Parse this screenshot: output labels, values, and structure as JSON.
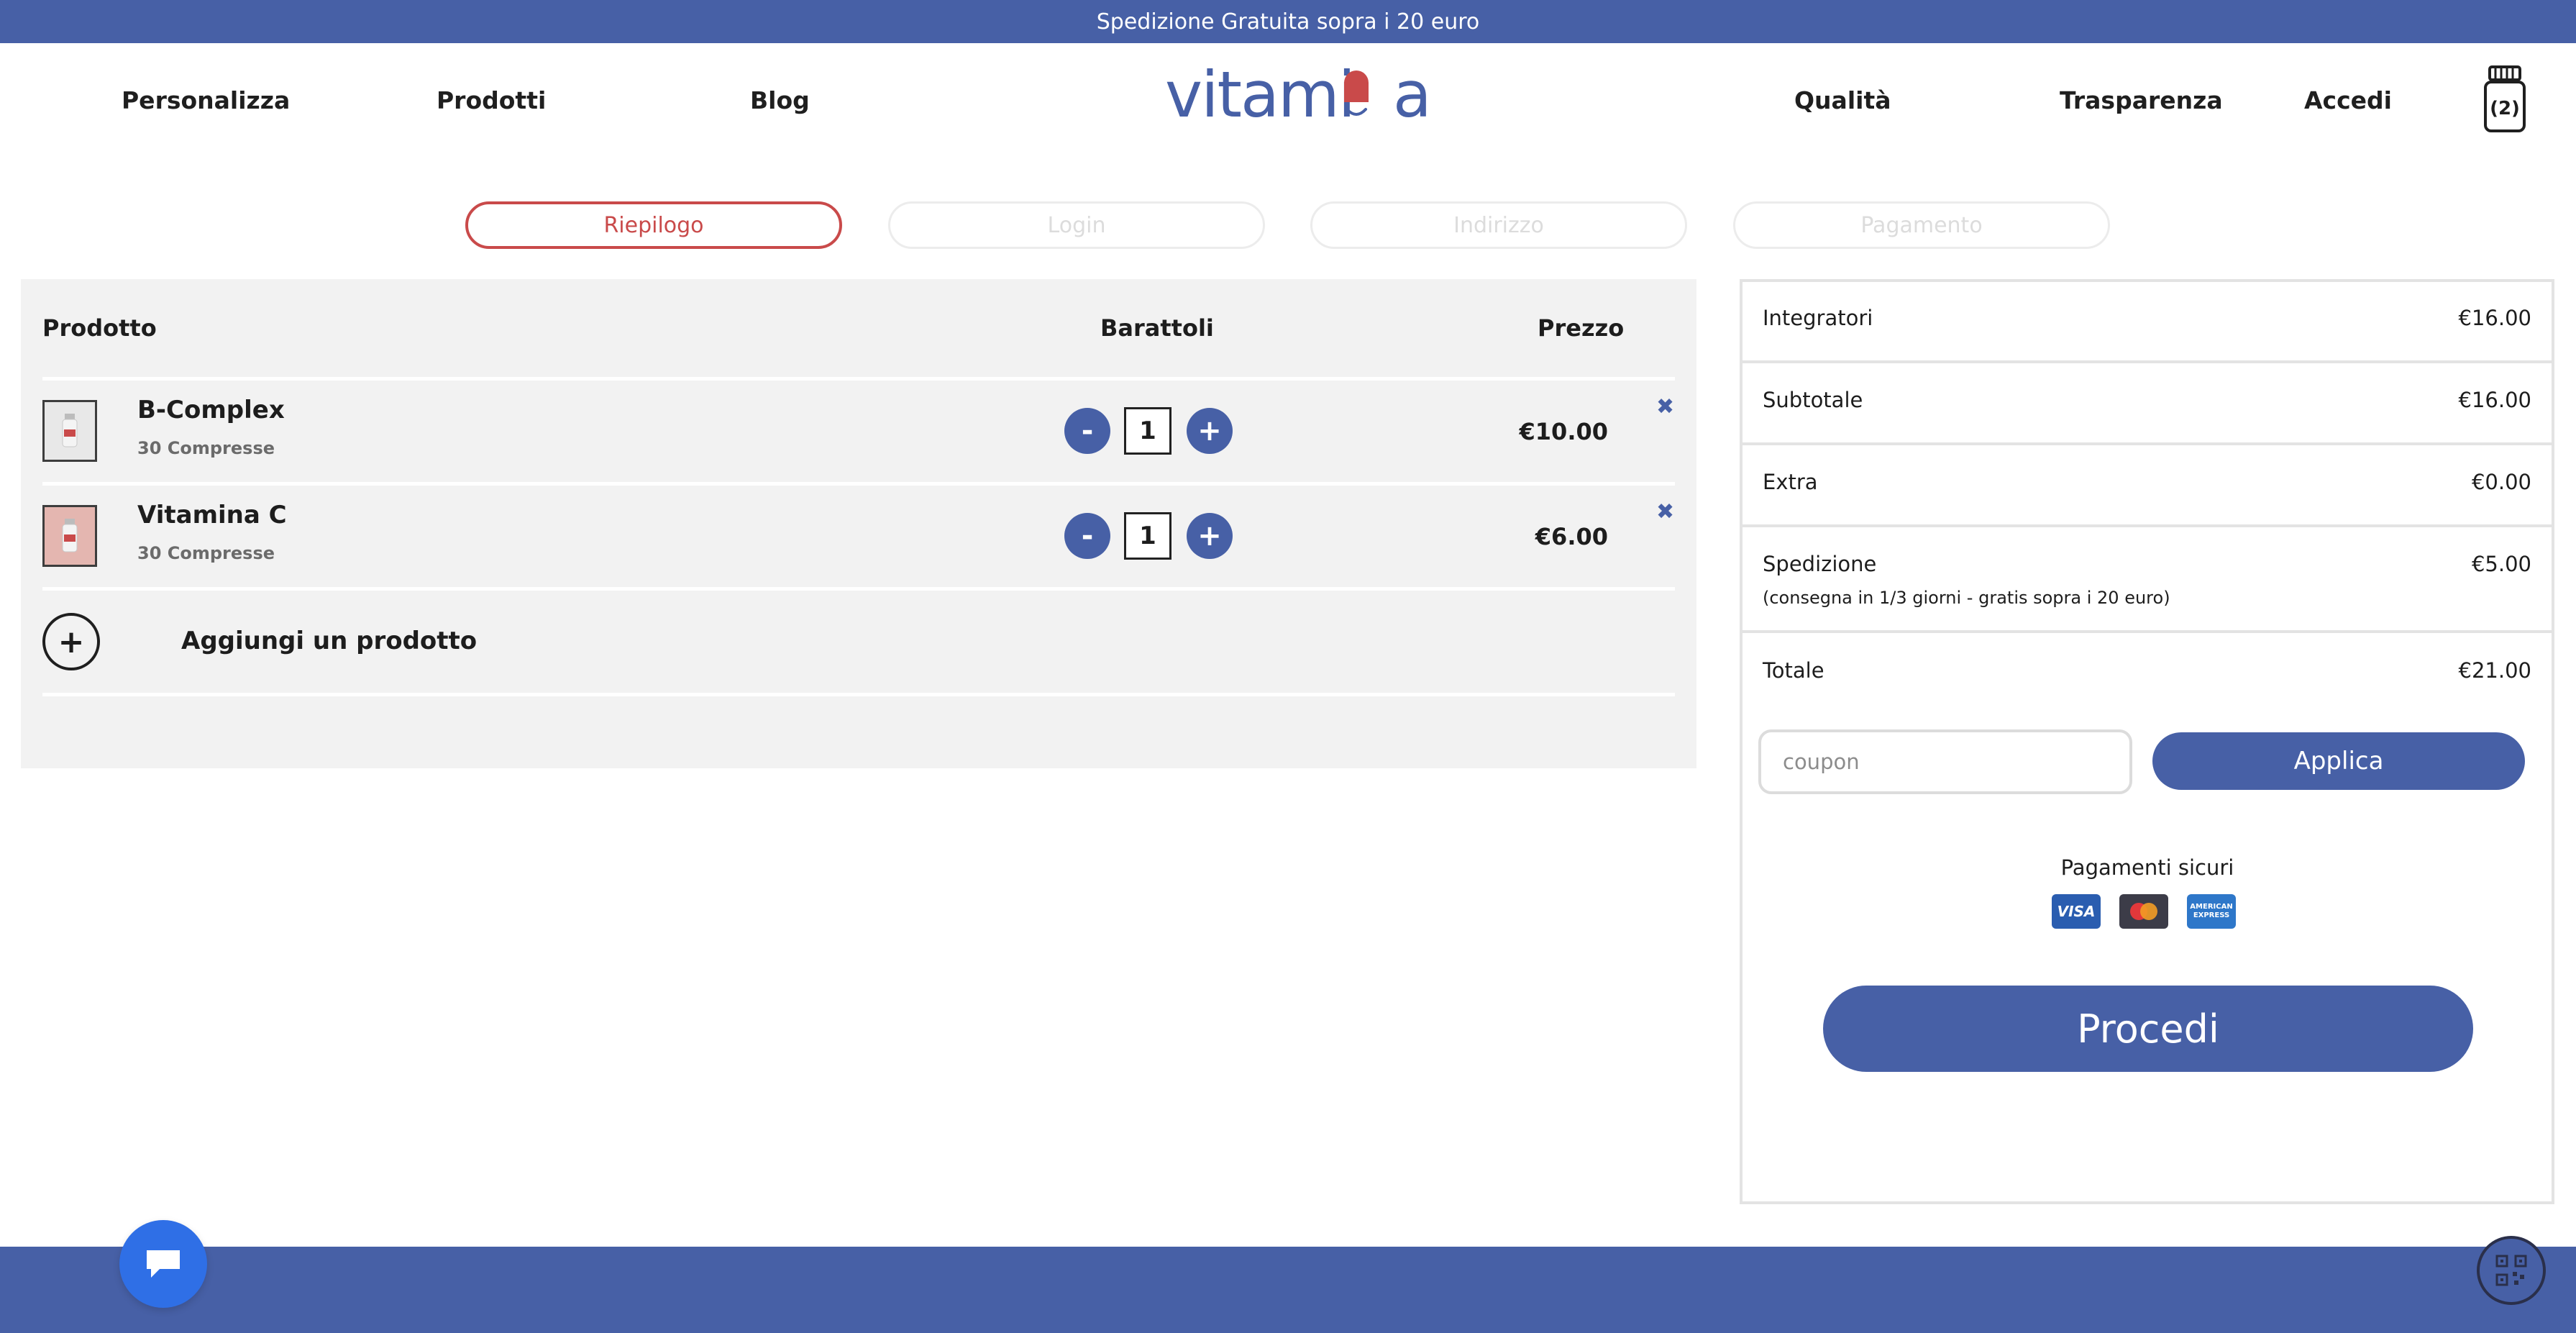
{
  "banner": {
    "text": "Spedizione Gratuita sopra i 20 euro"
  },
  "nav": {
    "left": [
      "Personalizza",
      "Prodotti",
      "Blog"
    ],
    "right": [
      "Qualità",
      "Trasparenza",
      "Accedi"
    ],
    "logo_text": "vitamina",
    "cart_count": "(2)"
  },
  "steps": [
    {
      "label": "Riepilogo",
      "state": "active"
    },
    {
      "label": "Login",
      "state": "inactive"
    },
    {
      "label": "Indirizzo",
      "state": "inactive"
    },
    {
      "label": "Pagamento",
      "state": "inactive"
    }
  ],
  "cart": {
    "headers": {
      "product": "Prodotto",
      "jars": "Barattoli",
      "price": "Prezzo"
    },
    "items": [
      {
        "name": "B-Complex",
        "subtitle": "30 Compresse",
        "qty": "1",
        "price": "€10.00",
        "minus": "-",
        "plus": "+",
        "remove": "✖"
      },
      {
        "name": "Vitamina C",
        "subtitle": "30 Compresse",
        "qty": "1",
        "price": "€6.00",
        "minus": "-",
        "plus": "+",
        "remove": "✖"
      }
    ],
    "add_product": {
      "icon": "+",
      "label": "Aggiungi un prodotto"
    }
  },
  "summary": {
    "rows": [
      {
        "label": "Integratori",
        "value": "€16.00"
      },
      {
        "label": "Subtotale",
        "value": "€16.00"
      },
      {
        "label": "Extra",
        "value": "€0.00"
      },
      {
        "label": "Spedizione",
        "value": "€5.00",
        "note": "(consegna in 1/3 giorni - gratis sopra i 20 euro)"
      },
      {
        "label": "Totale",
        "value": "€21.00"
      }
    ],
    "coupon_placeholder": "coupon",
    "apply_label": "Applica",
    "secure_label": "Pagamenti sicuri",
    "cards": [
      "VISA",
      "Mastercard",
      "AMERICAN EXPRESS"
    ],
    "proceed_label": "Procedi"
  },
  "colors": {
    "brand": "#4760a6",
    "accent_red": "#c94a4a",
    "chat": "#2f6fe6"
  }
}
